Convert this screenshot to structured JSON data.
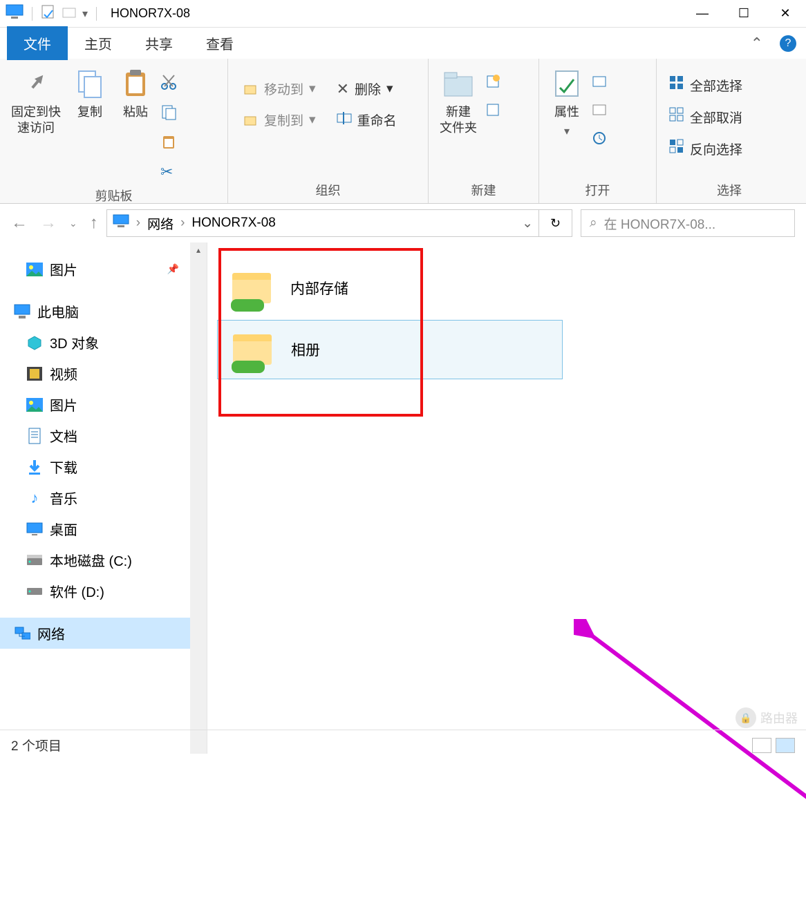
{
  "title": "HONOR7X-08",
  "tabs": {
    "file": "文件",
    "home": "主页",
    "share": "共享",
    "view": "查看"
  },
  "ribbon": {
    "clipboard": {
      "label": "剪贴板",
      "pin": "固定到快\n速访问",
      "copy": "复制",
      "paste": "粘贴"
    },
    "organize": {
      "label": "组织",
      "moveto": "移动到",
      "copyto": "复制到",
      "delete": "删除",
      "rename": "重命名"
    },
    "new_": {
      "label": "新建",
      "newfolder": "新建\n文件夹"
    },
    "open": {
      "label": "打开",
      "properties": "属性"
    },
    "select": {
      "label": "选择",
      "selectall": "全部选择",
      "selectnone": "全部取消",
      "invert": "反向选择"
    }
  },
  "breadcrumb": {
    "network": "网络",
    "host": "HONOR7X-08"
  },
  "search_placeholder": "在 HONOR7X-08...",
  "sidebar": {
    "pictures_quick": "图片",
    "thispc": "此电脑",
    "items": [
      {
        "label": "3D 对象"
      },
      {
        "label": "视频"
      },
      {
        "label": "图片"
      },
      {
        "label": "文档"
      },
      {
        "label": "下载"
      },
      {
        "label": "音乐"
      },
      {
        "label": "桌面"
      },
      {
        "label": "本地磁盘 (C:)"
      },
      {
        "label": "软件 (D:)"
      }
    ],
    "network": "网络"
  },
  "folders": [
    {
      "name": "内部存储"
    },
    {
      "name": "相册"
    }
  ],
  "status": "2 个项目",
  "watermark": "路由器"
}
